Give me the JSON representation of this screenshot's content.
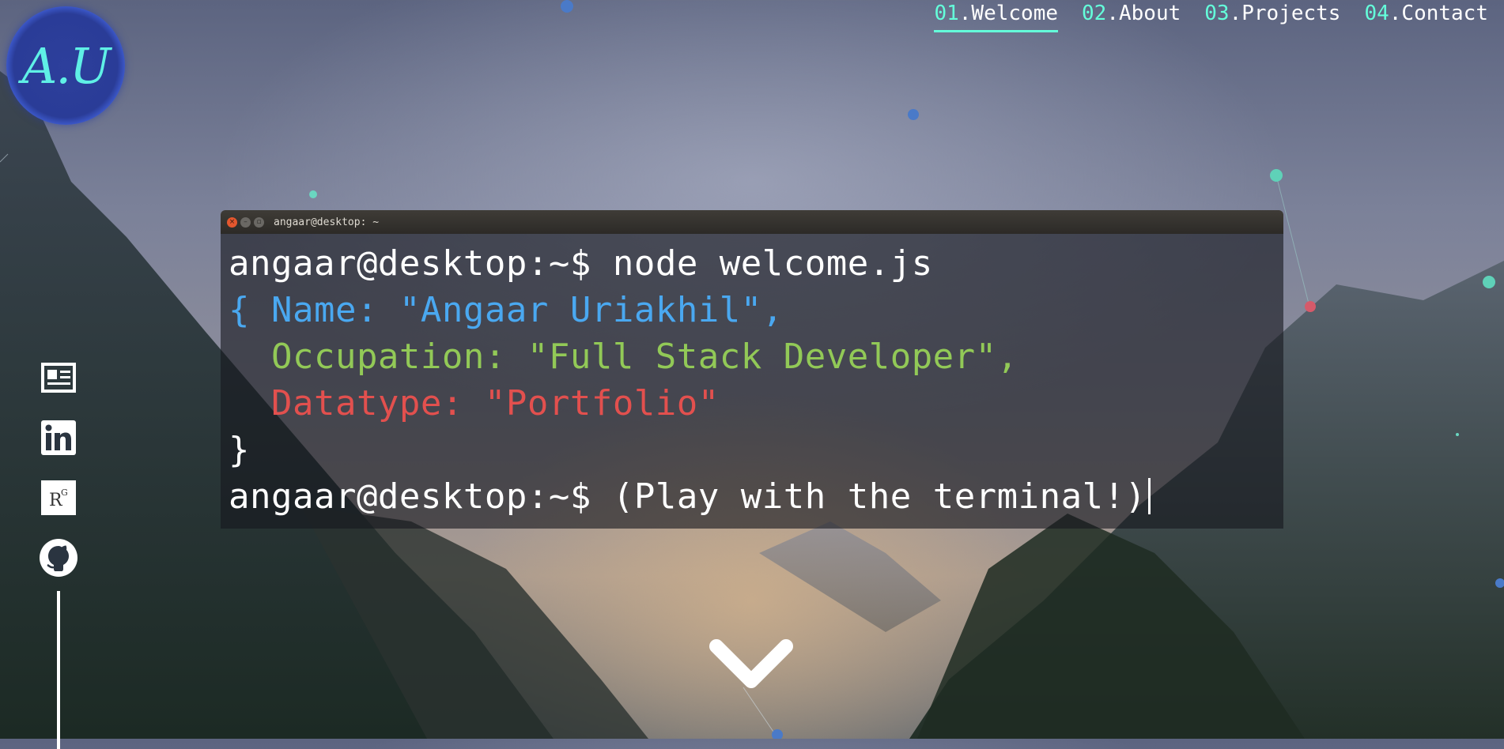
{
  "logo": {
    "text": "A.U"
  },
  "nav": [
    {
      "num": "01",
      "label": ".Welcome",
      "active": true
    },
    {
      "num": "02",
      "label": ".About",
      "active": false
    },
    {
      "num": "03",
      "label": ".Projects",
      "active": false
    },
    {
      "num": "04",
      "label": ".Contact",
      "active": false
    }
  ],
  "terminal": {
    "title": "angaar@desktop: ~",
    "prompt": "angaar@desktop:~$",
    "command": "node welcome.js",
    "open_brace": "{",
    "name_line": "Name: \"Angaar Uriakhil\",",
    "occupation_line": "Occupation: \"Full Stack Developer\",",
    "datatype_line": "Datatype: \"Portfolio\"",
    "close_brace": "}",
    "input_text": "(Play with the terminal!)"
  },
  "social": [
    {
      "icon": "resume-icon"
    },
    {
      "icon": "linkedin-icon"
    },
    {
      "icon": "researchgate-icon",
      "text": "R",
      "sup": "G"
    },
    {
      "icon": "github-icon"
    }
  ],
  "scroll_indicator": {
    "icon": "chevron-down-icon"
  },
  "colors": {
    "accent": "#64ffda",
    "json_key": "#4aa8f0",
    "json_string": "#92c957",
    "json_error": "#e2504e",
    "logo_bg": "#2a3c97"
  }
}
